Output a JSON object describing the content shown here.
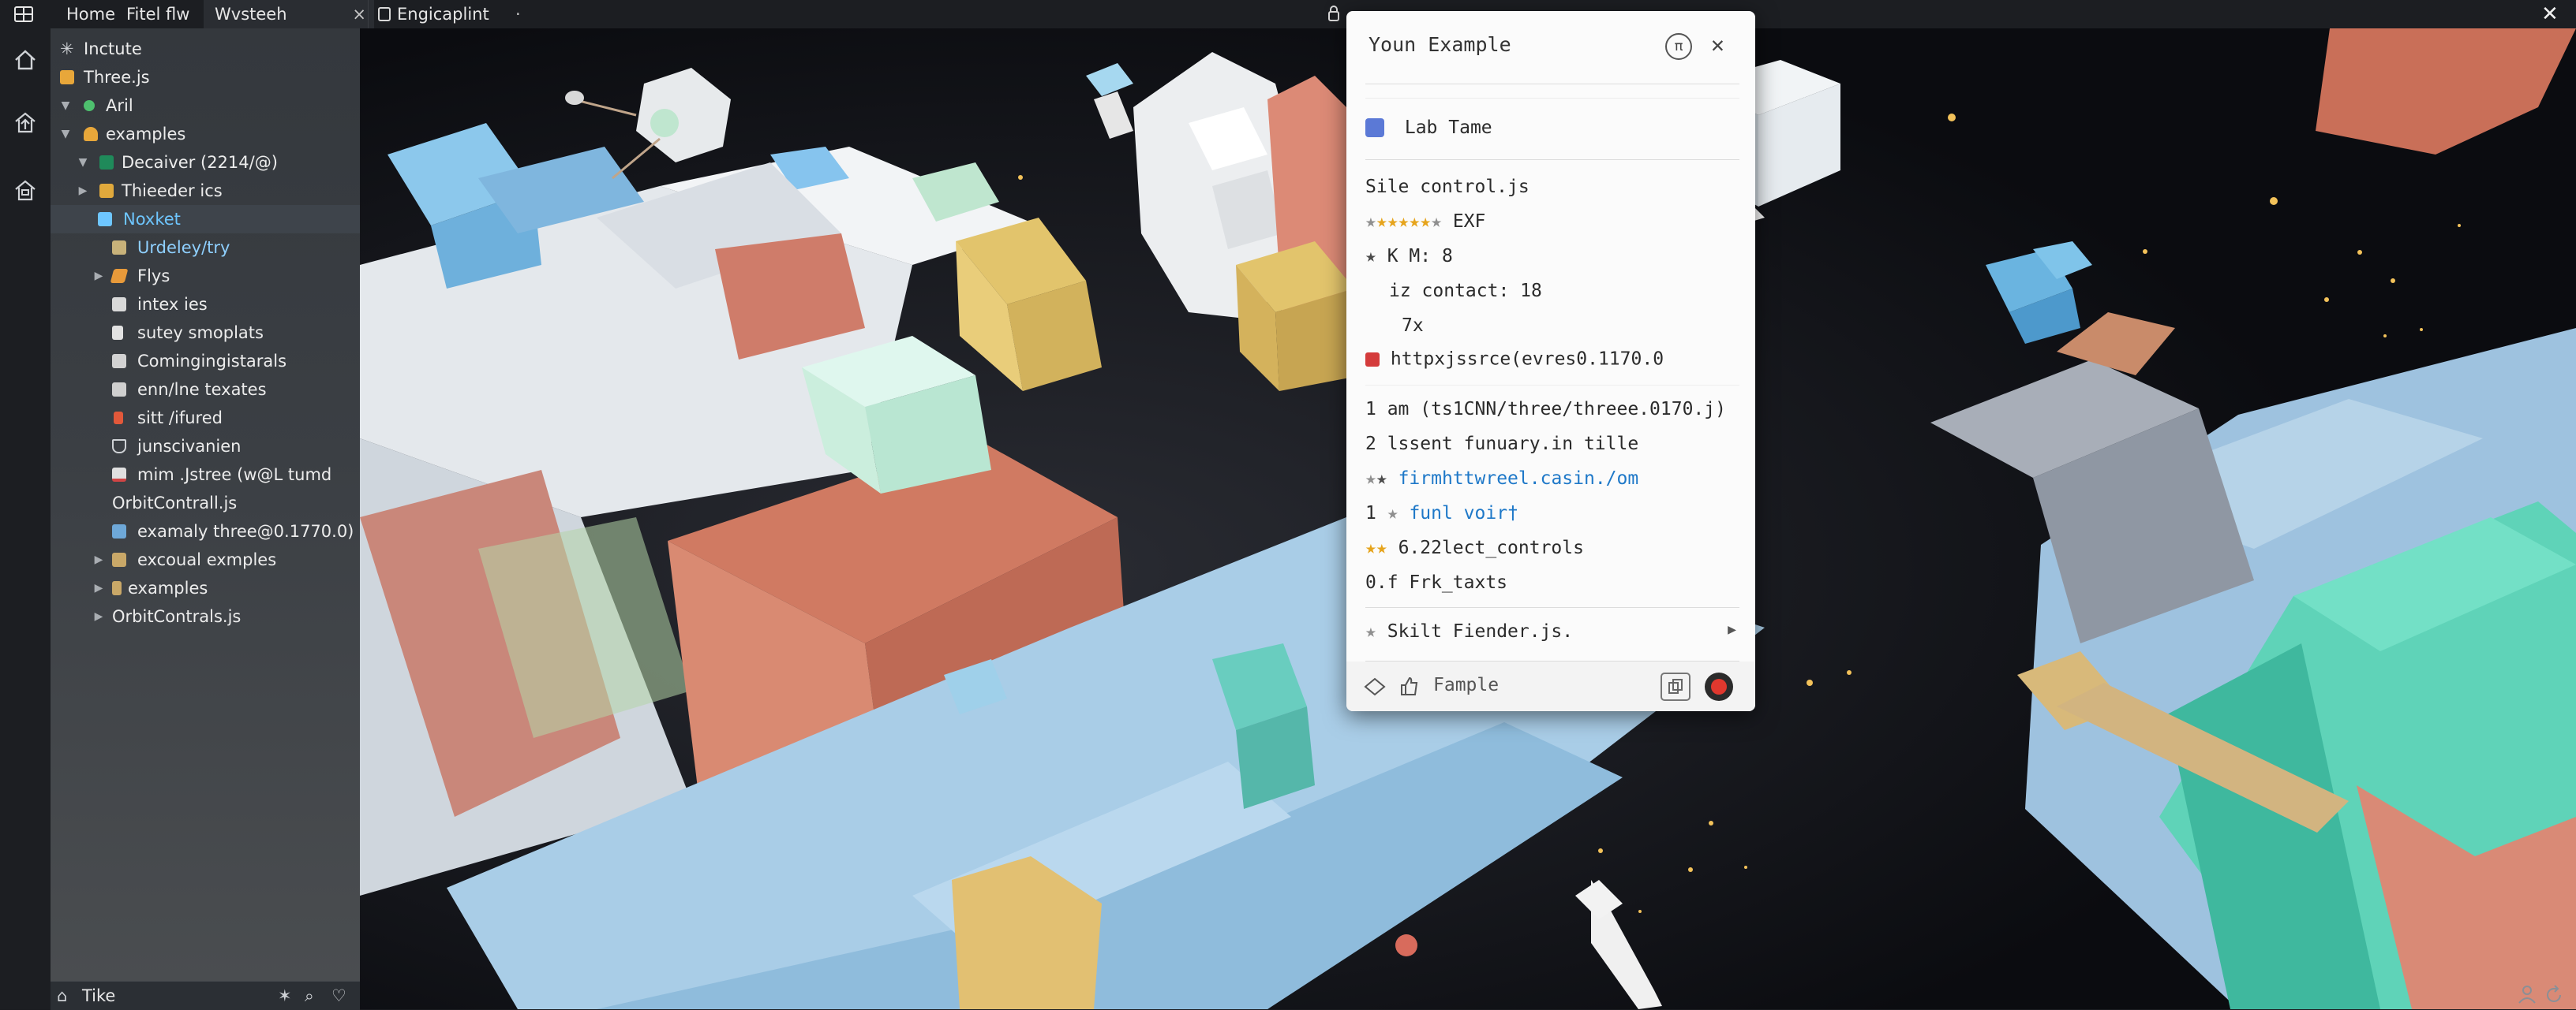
{
  "top_tabs": {
    "home": "Home",
    "fitel": "Fitel flw",
    "wvsteeh": "Wvsteeh",
    "close": "×",
    "engicaplint": "Engicaplint",
    "dot": "·"
  },
  "window": {
    "close": "✕"
  },
  "sidebar": {
    "items": [
      {
        "label": "Inctute"
      },
      {
        "label": "Three.js"
      },
      {
        "label": "Aril"
      },
      {
        "label": "examples"
      },
      {
        "label": "Decaiver (2214/@)"
      },
      {
        "label": "Thieeder ics"
      },
      {
        "label": "Noxket"
      },
      {
        "label": "Urdeley/try"
      },
      {
        "label": "Flys"
      },
      {
        "label": "intex ies"
      },
      {
        "label": "sutey smoplats"
      },
      {
        "label": "Comingingistarals"
      },
      {
        "label": "enn/lne texates"
      },
      {
        "label": "sitt /ifured"
      },
      {
        "label": "junscivanien"
      },
      {
        "label": "mim .Jstree (w@L tumd"
      },
      {
        "label": "OrbitContrall.js"
      },
      {
        "label": "examaly three@0.1770.0)"
      },
      {
        "label": "excoual exmples"
      },
      {
        "label": "examples"
      },
      {
        "label": "OrbitContrals.js"
      }
    ]
  },
  "statusbar": {
    "label": "Tike"
  },
  "panel": {
    "title": "Youn Example",
    "pi_button": "π",
    "close": "✕",
    "lab_name": "Lab Tame",
    "lines": {
      "file": "Sile control.js",
      "rating_label": "EXF",
      "km": "K M: 8",
      "contact": "iz contact: 18",
      "seven": "7x",
      "url1": "httpxjssrce(evres0.1170.0",
      "line_am": "1 am (ts1CNN/three/threee.0170.j)",
      "line_lssent": "2 lssent funuary.in tille",
      "link1": "firmhttwreel.casin./om",
      "one": "1",
      "link2": "funl voir†",
      "controls": "6.22lect_controls",
      "frk": "0.f Frk_taxts",
      "skilt": "Skilt Fiender.js."
    },
    "footer": {
      "label": "Fample"
    }
  },
  "colors": {
    "accent_blue": "#1e78c8",
    "star": "#e6a41c",
    "selected_folder": "#6ec6ff"
  }
}
